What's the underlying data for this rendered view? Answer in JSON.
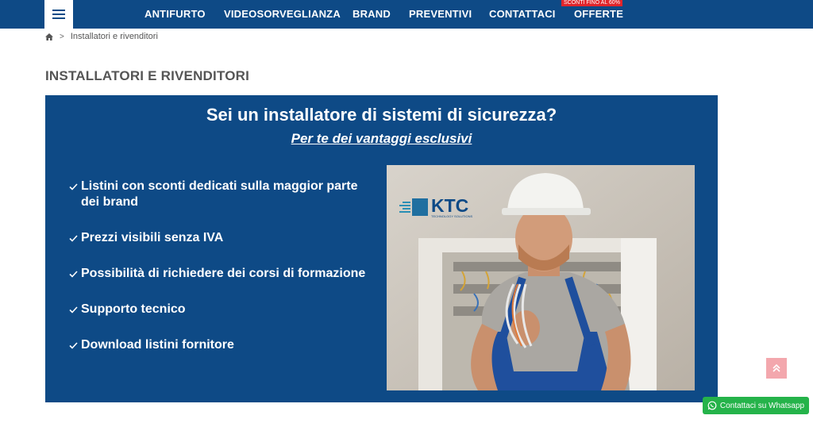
{
  "nav": {
    "items": [
      {
        "label": "ANTIFURTO"
      },
      {
        "label": "VIDEOSORVEGLIANZA"
      },
      {
        "label": "BRAND"
      },
      {
        "label": "PREVENTIVI"
      },
      {
        "label": "CONTATTACI"
      },
      {
        "label": "OFFERTE"
      }
    ],
    "promo_badge": "SCONTI FINO AL 60%"
  },
  "breadcrumb": {
    "separator": ">",
    "current": "Installatori e rivenditori"
  },
  "page_title": "INSTALLATORI E RIVENDITORI",
  "banner": {
    "heading": "Sei un installatore di sistemi di sicurezza?",
    "subheading": "Per te dei vantaggi esclusivi",
    "benefits": [
      "Listini con sconti dedicati sulla maggior parte dei brand",
      "Prezzi visibili senza IVA",
      "Possibilità di richiedere dei corsi di formazione",
      "Supporto tecnico",
      "Download listini fornitore"
    ],
    "logo_text": "KTC",
    "logo_tagline": "TECHNOLOGY SOLUTIONS"
  },
  "whatsapp": {
    "label": "Contattaci su Whatsapp"
  },
  "colors": {
    "brand_blue": "#0e4a86",
    "promo_red": "#e1252b",
    "whatsapp_green": "#25b34a",
    "to_top_pink": "#f3a7ad"
  },
  "icons": [
    "menu-icon",
    "home-icon",
    "check-icon",
    "chevron-up-icon",
    "whatsapp-icon"
  ]
}
